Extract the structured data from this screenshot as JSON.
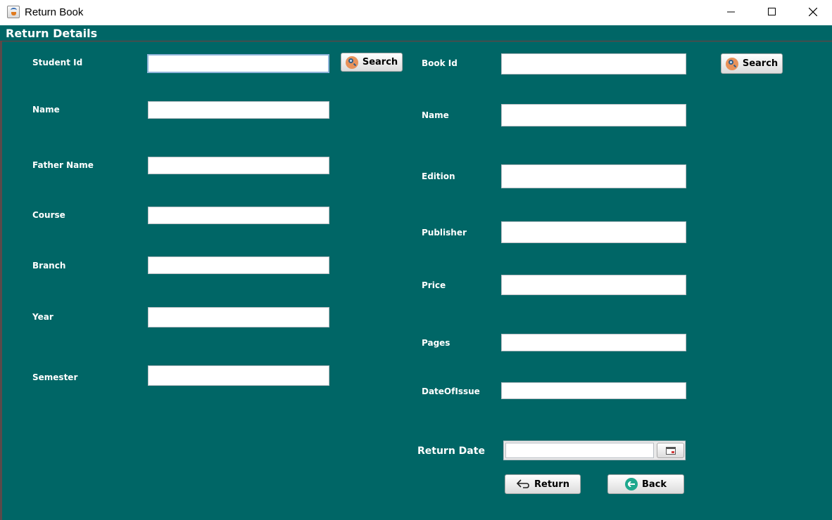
{
  "window": {
    "title": "Return Book",
    "controls": [
      "minimize-icon",
      "maximize-icon",
      "close-icon"
    ]
  },
  "panel": {
    "title": "Return Details"
  },
  "student": {
    "student_id_label": "Student Id",
    "student_id_value": "",
    "search_label": "Search",
    "name_label": "Name",
    "name_value": "",
    "father_name_label": "Father Name",
    "father_name_value": "",
    "course_label": "Course",
    "course_value": "",
    "branch_label": "Branch",
    "branch_value": "",
    "year_label": "Year",
    "year_value": "",
    "semester_label": "Semester",
    "semester_value": ""
  },
  "book": {
    "book_id_label": "Book Id",
    "book_id_value": "",
    "search_label": "Search",
    "name_label": "Name",
    "name_value": "",
    "edition_label": "Edition",
    "edition_value": "",
    "publisher_label": "Publisher",
    "publisher_value": "",
    "price_label": "Price",
    "price_value": "",
    "pages_label": "Pages",
    "pages_value": "",
    "date_of_issue_label": "DateOfIssue",
    "date_of_issue_value": ""
  },
  "return": {
    "return_date_label": "Return Date",
    "return_date_value": "",
    "return_button_label": "Return",
    "back_button_label": "Back"
  },
  "colors": {
    "background": "#006666",
    "label": "#ffffff",
    "field": "#ffffff"
  },
  "icons": [
    "search-icon",
    "calendar-icon",
    "return-arrow-icon",
    "back-arrow-icon"
  ]
}
